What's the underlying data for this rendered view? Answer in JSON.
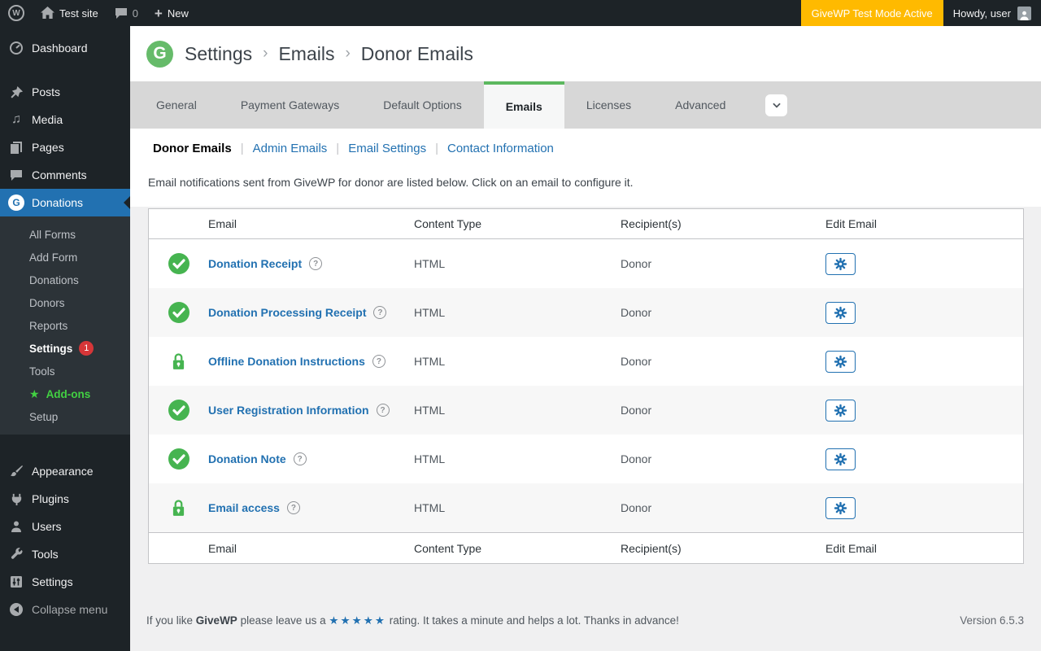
{
  "colors": {
    "adminbar_bg": "#1d2327",
    "accent_blue": "#2271b1",
    "give_green": "#66bb6a",
    "status_green": "#46b450",
    "test_mode_orange": "#ffba00",
    "badge_red": "#d63638",
    "addons_green": "#42d142",
    "page_bg": "#f0f0f1",
    "table_border": "#c3c4c7"
  },
  "admin_bar": {
    "site_name": "Test site",
    "comment_count": "0",
    "new_label": "New",
    "wp_logo_glyph": "W",
    "test_mode_badge": "GiveWP Test Mode Active",
    "greeting": "Howdy, user"
  },
  "sidebar": {
    "top_items": [
      {
        "label": "Dashboard"
      },
      {
        "label": "Posts"
      },
      {
        "label": "Media"
      },
      {
        "label": "Pages"
      },
      {
        "label": "Comments"
      },
      {
        "label": "Donations",
        "active": true
      }
    ],
    "donations_submenu": [
      {
        "label": "All Forms"
      },
      {
        "label": "Add Form"
      },
      {
        "label": "Donations"
      },
      {
        "label": "Donors"
      },
      {
        "label": "Reports"
      },
      {
        "label": "Settings",
        "badge": "1",
        "current": true
      },
      {
        "label": "Tools"
      },
      {
        "label": "Add-ons",
        "starred": true,
        "star_glyph": "★"
      },
      {
        "label": "Setup"
      }
    ],
    "bottom_items": [
      {
        "label": "Appearance"
      },
      {
        "label": "Plugins"
      },
      {
        "label": "Users"
      },
      {
        "label": "Tools"
      },
      {
        "label": "Settings"
      },
      {
        "label": "Collapse menu"
      }
    ],
    "give_logo_glyph": "G",
    "media_glyph": "♫"
  },
  "breadcrumb": {
    "separator": "›",
    "logo_glyph": "G",
    "items": [
      "Settings",
      "Emails",
      "Donor Emails"
    ]
  },
  "tabs": {
    "items": [
      {
        "label": "General"
      },
      {
        "label": "Payment Gateways"
      },
      {
        "label": "Default Options"
      },
      {
        "label": "Emails",
        "active": true
      },
      {
        "label": "Licenses"
      },
      {
        "label": "Advanced"
      }
    ]
  },
  "subnav": {
    "separator": "|",
    "items": [
      {
        "label": "Donor Emails",
        "active": true
      },
      {
        "label": "Admin Emails"
      },
      {
        "label": "Email Settings"
      },
      {
        "label": "Contact Information"
      }
    ]
  },
  "description": "Email notifications sent from GiveWP for donor are listed below. Click on an email to configure it.",
  "table": {
    "headers": {
      "email": "Email",
      "content_type": "Content Type",
      "recipients": "Recipient(s)",
      "edit": "Edit Email"
    },
    "help_glyph": "?",
    "rows": [
      {
        "title": "Donation Receipt",
        "status_icon": "check",
        "content_type": "HTML",
        "recipients": "Donor"
      },
      {
        "title": "Donation Processing Receipt",
        "status_icon": "check",
        "content_type": "HTML",
        "recipients": "Donor"
      },
      {
        "title": "Offline Donation Instructions",
        "status_icon": "lock",
        "content_type": "HTML",
        "recipients": "Donor"
      },
      {
        "title": "User Registration Information",
        "status_icon": "check",
        "content_type": "HTML",
        "recipients": "Donor"
      },
      {
        "title": "Donation Note",
        "status_icon": "check",
        "content_type": "HTML",
        "recipients": "Donor"
      },
      {
        "title": "Email access",
        "status_icon": "lock",
        "content_type": "HTML",
        "recipients": "Donor"
      }
    ]
  },
  "footer": {
    "rating_prefix": "If you like",
    "brand": "GiveWP",
    "rating_mid": "please leave us a",
    "stars": "★★★★★",
    "rating_suffix": "rating. It takes a minute and helps a lot. Thanks in advance!",
    "version": "Version 6.5.3"
  }
}
